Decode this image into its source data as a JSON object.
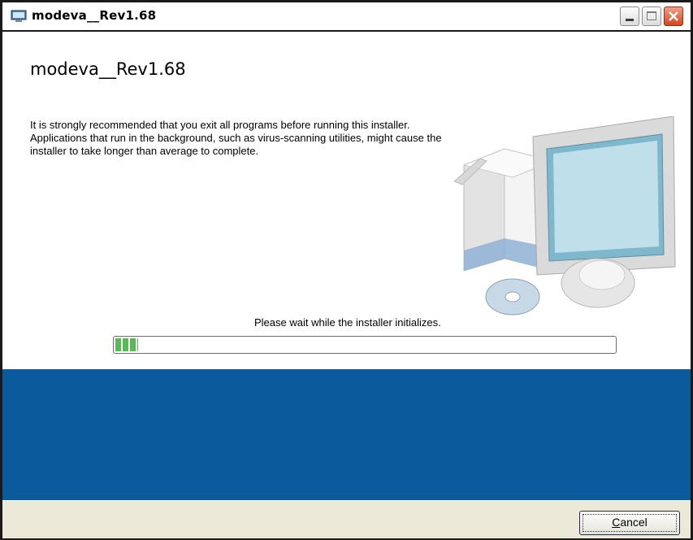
{
  "window": {
    "title": "modeva__Rev1.68",
    "icon": "installer-icon",
    "controls": [
      "minimize-icon",
      "maximize-icon",
      "close-icon"
    ]
  },
  "content": {
    "heading": "modeva__Rev1.68",
    "note": "It is strongly recommended that you exit all programs before running this installer. Applications that run in the background, such as virus-scanning utilities, might cause the installer to take longer than average to complete.",
    "illustration": "computer-with-cd-icon",
    "status": "Please wait while the installer initializes.",
    "progress": 0.045
  },
  "footer": {
    "cancel_mnemonic": "C",
    "cancel_rest": "ancel"
  },
  "colors": {
    "band": "#0b5a9c",
    "progress": "#58b956",
    "footer": "#ece9d8"
  }
}
